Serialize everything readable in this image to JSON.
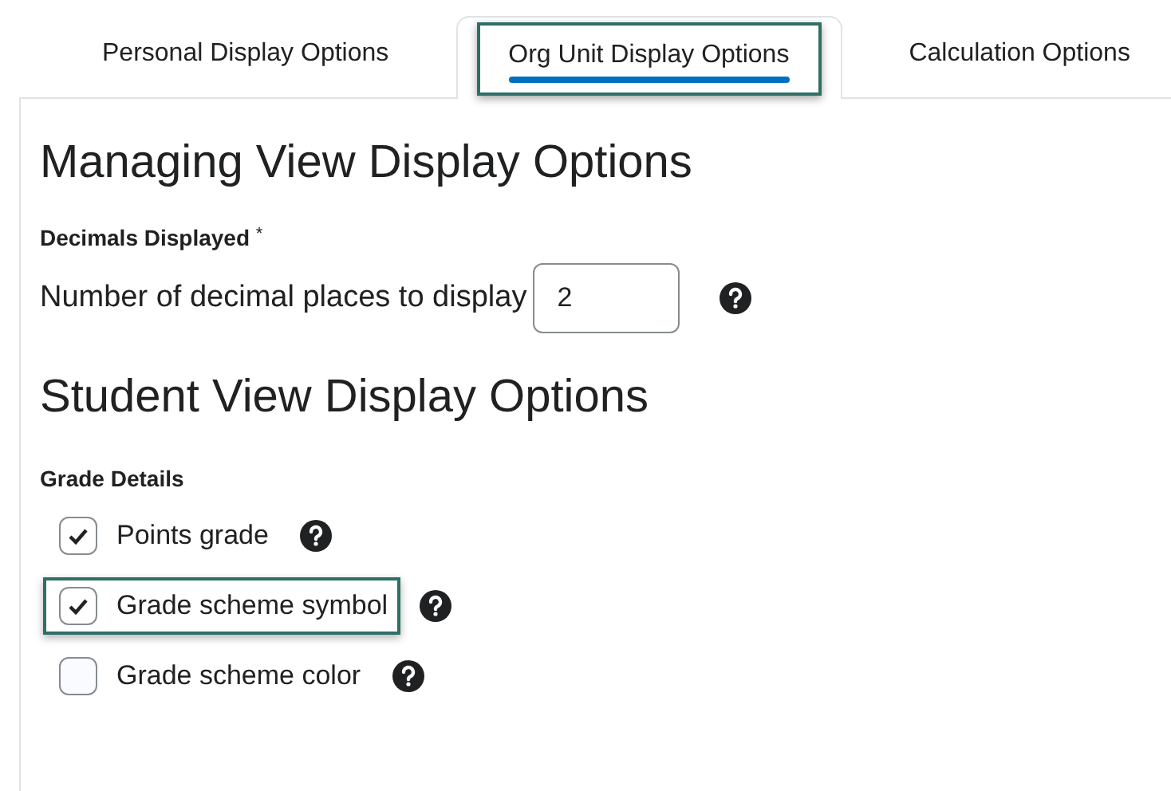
{
  "tabs": [
    {
      "label": "Personal Display Options",
      "selected": false,
      "highlighted": false
    },
    {
      "label": "Org Unit Display Options",
      "selected": true,
      "highlighted": true
    },
    {
      "label": "Calculation Options",
      "selected": false,
      "highlighted": false
    }
  ],
  "managing": {
    "heading": "Managing View Display Options",
    "field_label": "Decimals Displayed",
    "required_mark": "*",
    "prompt": "Number of decimal places to display",
    "value": "2"
  },
  "student": {
    "heading": "Student View Display Options",
    "group_label": "Grade Details",
    "options": [
      {
        "label": "Points grade",
        "checked": true,
        "highlighted": false
      },
      {
        "label": "Grade scheme symbol",
        "checked": true,
        "highlighted": true
      },
      {
        "label": "Grade scheme color",
        "checked": false,
        "highlighted": false
      }
    ]
  }
}
